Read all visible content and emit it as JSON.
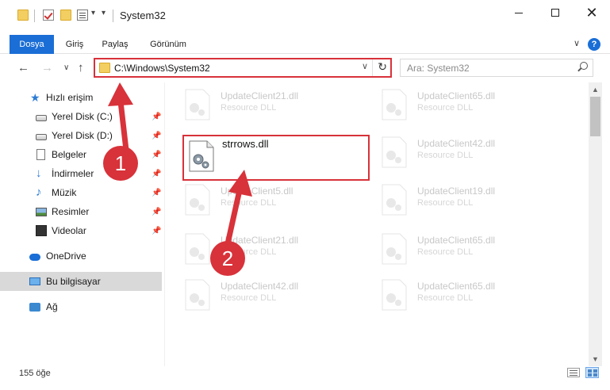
{
  "titlebar": {
    "title": "System32",
    "quick_access": [
      "folder-icon",
      "check-properties-icon",
      "new-folder-icon",
      "properties-icon",
      "customize-dropdown-icon"
    ],
    "buttons": [
      "minimize",
      "maximize",
      "close"
    ]
  },
  "ribbon": {
    "tabs": [
      {
        "label": "Dosya",
        "active": true
      },
      {
        "label": "Giriş"
      },
      {
        "label": "Paylaş"
      },
      {
        "label": "Görünüm"
      }
    ],
    "help": "?"
  },
  "address": {
    "path": "C:\\Windows\\System32",
    "refresh_icon": "↻"
  },
  "search": {
    "placeholder": "Ara: System32"
  },
  "nav": {
    "items": [
      {
        "label": "Hızlı erişim",
        "icon": "star-icon",
        "pinned": false
      },
      {
        "label": "Yerel Disk (C:)",
        "icon": "drive-icon",
        "pinned": true
      },
      {
        "label": "Yerel Disk (D:)",
        "icon": "drive-icon",
        "pinned": true
      },
      {
        "label": "Belgeler",
        "icon": "document-icon",
        "pinned": true
      },
      {
        "label": "İndirmeler",
        "icon": "download-icon",
        "pinned": true
      },
      {
        "label": "Müzik",
        "icon": "music-icon",
        "pinned": true
      },
      {
        "label": "Resimler",
        "icon": "pictures-icon",
        "pinned": true
      },
      {
        "label": "Videolar",
        "icon": "video-icon",
        "pinned": true
      },
      {
        "label": "OneDrive",
        "icon": "onedrive-icon",
        "pinned": false
      },
      {
        "label": "Bu bilgisayar",
        "icon": "this-pc-icon",
        "pinned": false,
        "selected": true
      },
      {
        "label": "Ağ",
        "icon": "network-icon",
        "pinned": false
      }
    ]
  },
  "files": {
    "left_column": [
      {
        "name": "UpdateClient21.dll",
        "type": "Resource DLL"
      },
      {
        "name": "UpdateClient5.dll",
        "type": "Resource DLL"
      },
      {
        "name": "UpdateClient21.dll",
        "type": "Resource DLL"
      },
      {
        "name": "UpdateClient42.dll",
        "type": "Resource DLL"
      }
    ],
    "right_column": [
      {
        "name": "UpdateClient65.dll",
        "type": "Resource DLL"
      },
      {
        "name": "UpdateClient42.dll",
        "type": "Resource DLL"
      },
      {
        "name": "UpdateClient19.dll",
        "type": "Resource DLL"
      },
      {
        "name": "UpdateClient65.dll",
        "type": "Resource DLL"
      },
      {
        "name": "UpdateClient65.dll",
        "type": "Resource DLL"
      }
    ],
    "highlighted": {
      "name": "strrows.dll"
    }
  },
  "status": {
    "count": "155 öğe"
  },
  "annotations": {
    "step1": "1",
    "step2": "2",
    "accent_color": "#d8323a"
  }
}
